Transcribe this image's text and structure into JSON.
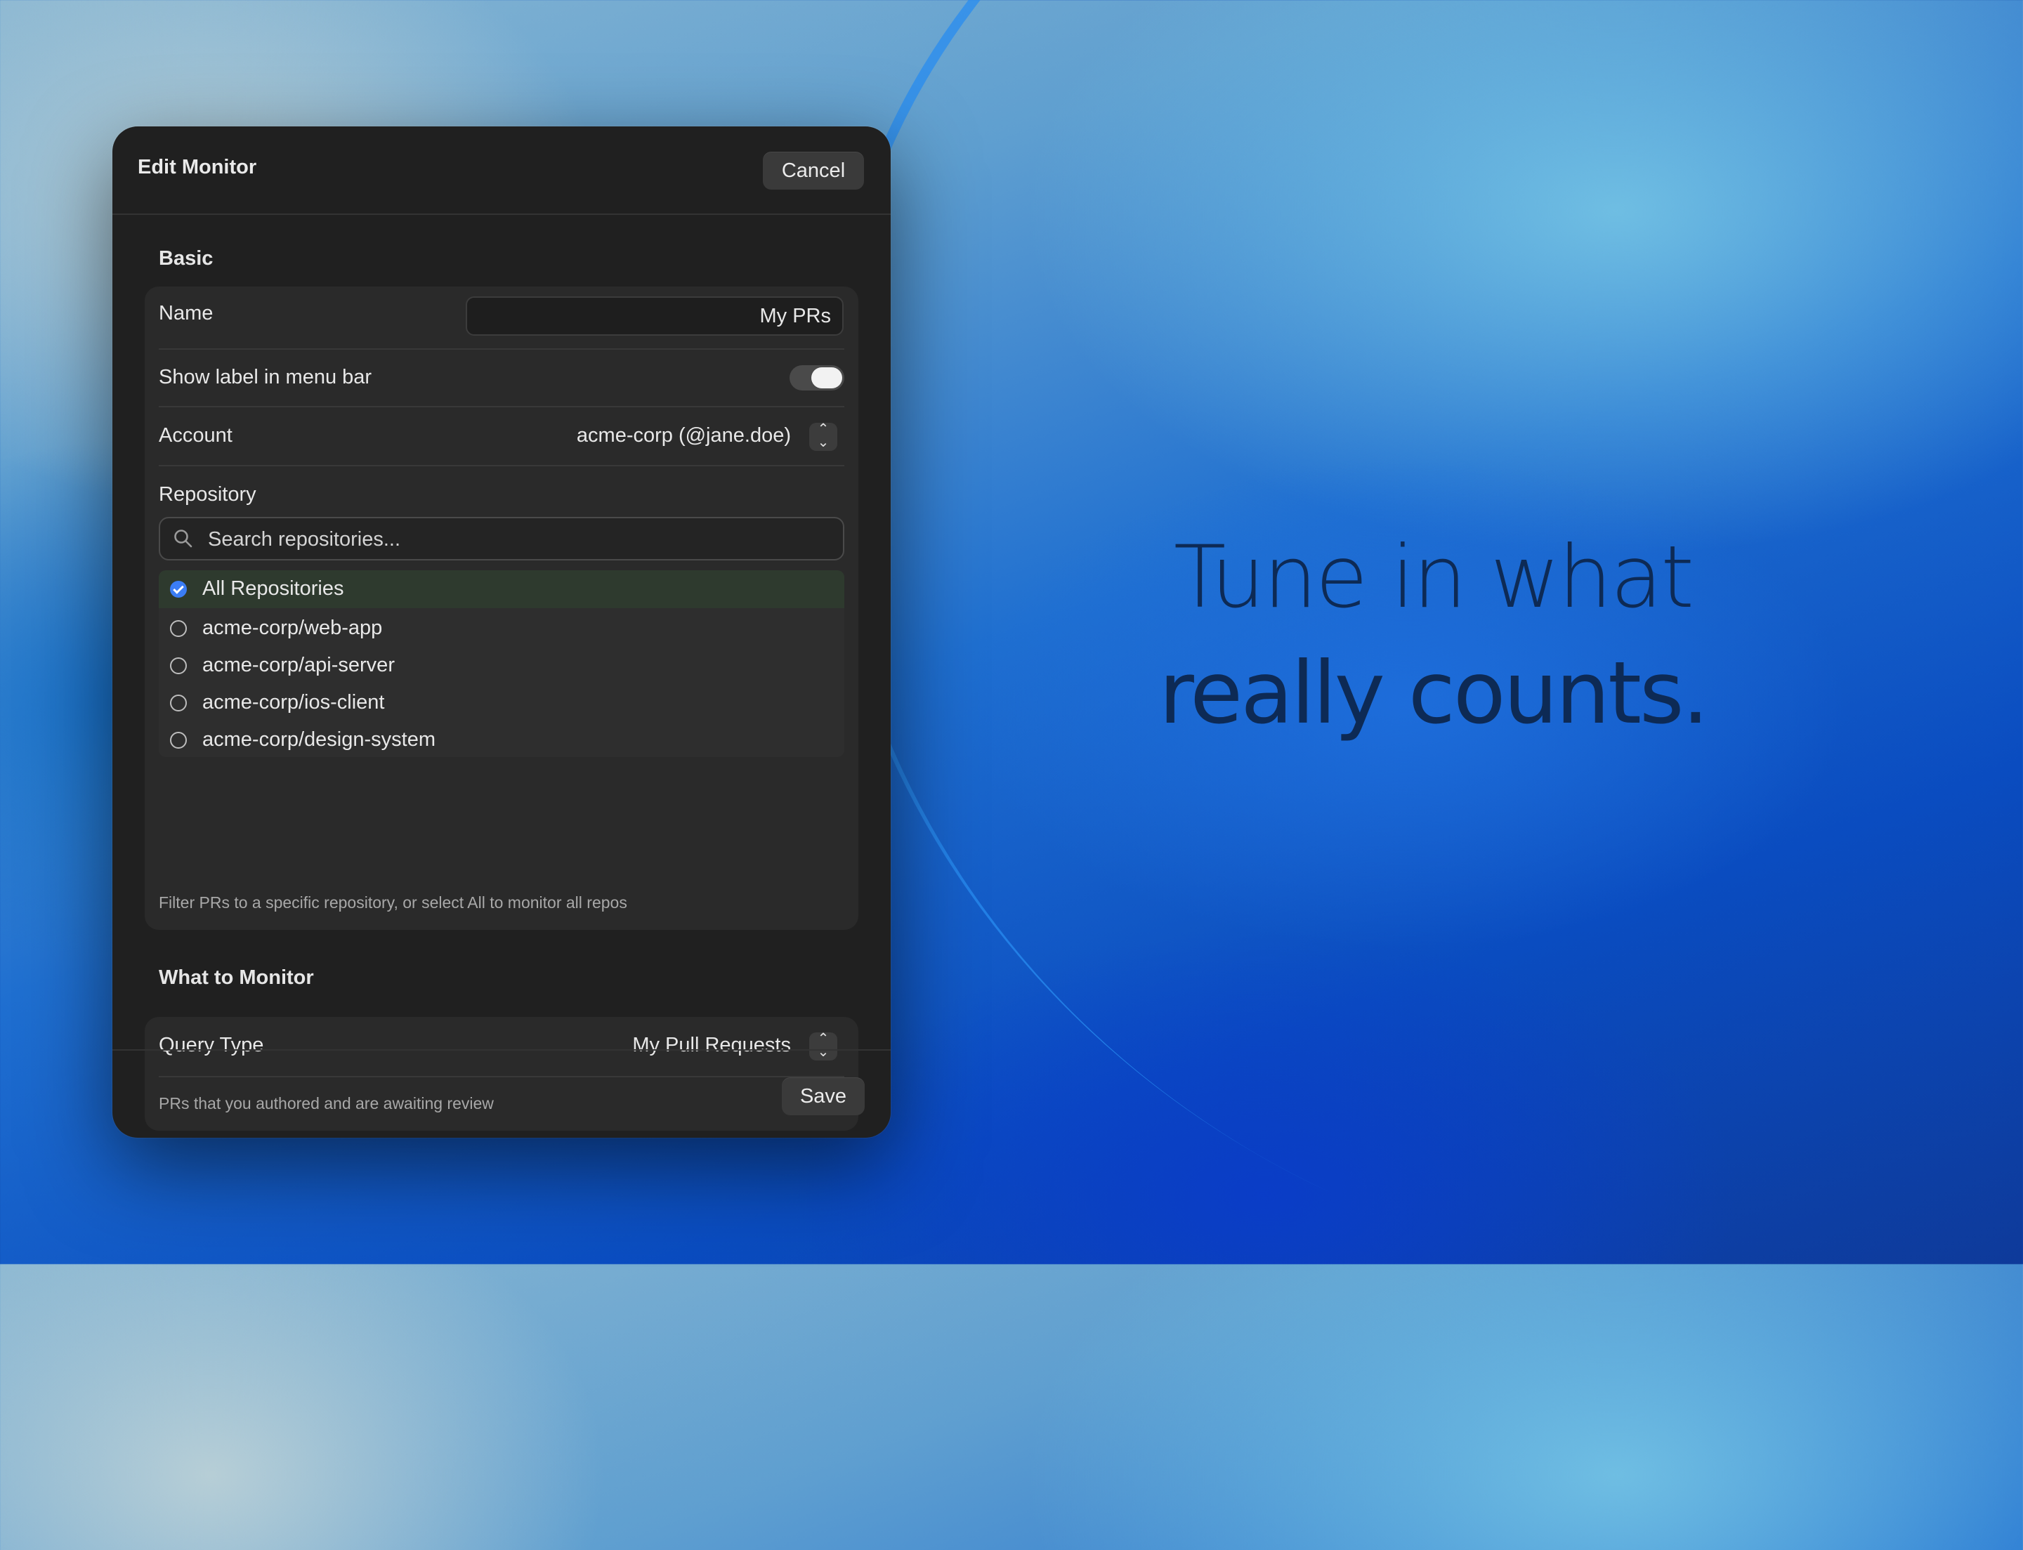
{
  "window": {
    "title": "Edit Monitor",
    "cancel_label": "Cancel",
    "save_label": "Save"
  },
  "basic": {
    "section_title": "Basic",
    "name_label": "Name",
    "name_value": "My PRs",
    "show_label_text": "Show label in menu bar",
    "show_label_enabled": true,
    "account_label": "Account",
    "account_value": "acme-corp (@jane.doe)",
    "repository_label": "Repository",
    "search_placeholder": "Search repositories...",
    "repositories": [
      {
        "name": "All Repositories",
        "selected": true
      },
      {
        "name": "acme-corp/web-app",
        "selected": false
      },
      {
        "name": "acme-corp/api-server",
        "selected": false
      },
      {
        "name": "acme-corp/ios-client",
        "selected": false
      },
      {
        "name": "acme-corp/design-system",
        "selected": false
      }
    ],
    "repository_hint": "Filter PRs to a specific repository, or select All to monitor all repos"
  },
  "monitor": {
    "section_title": "What to Monitor",
    "query_type_label": "Query Type",
    "query_type_value": "My Pull Requests",
    "query_hint": "PRs that you authored and are awaiting review"
  },
  "tagline": {
    "line1": "Tune in what",
    "line2": "really counts."
  },
  "colors": {
    "accent": "#3b7df5",
    "window_bg": "#202020"
  }
}
